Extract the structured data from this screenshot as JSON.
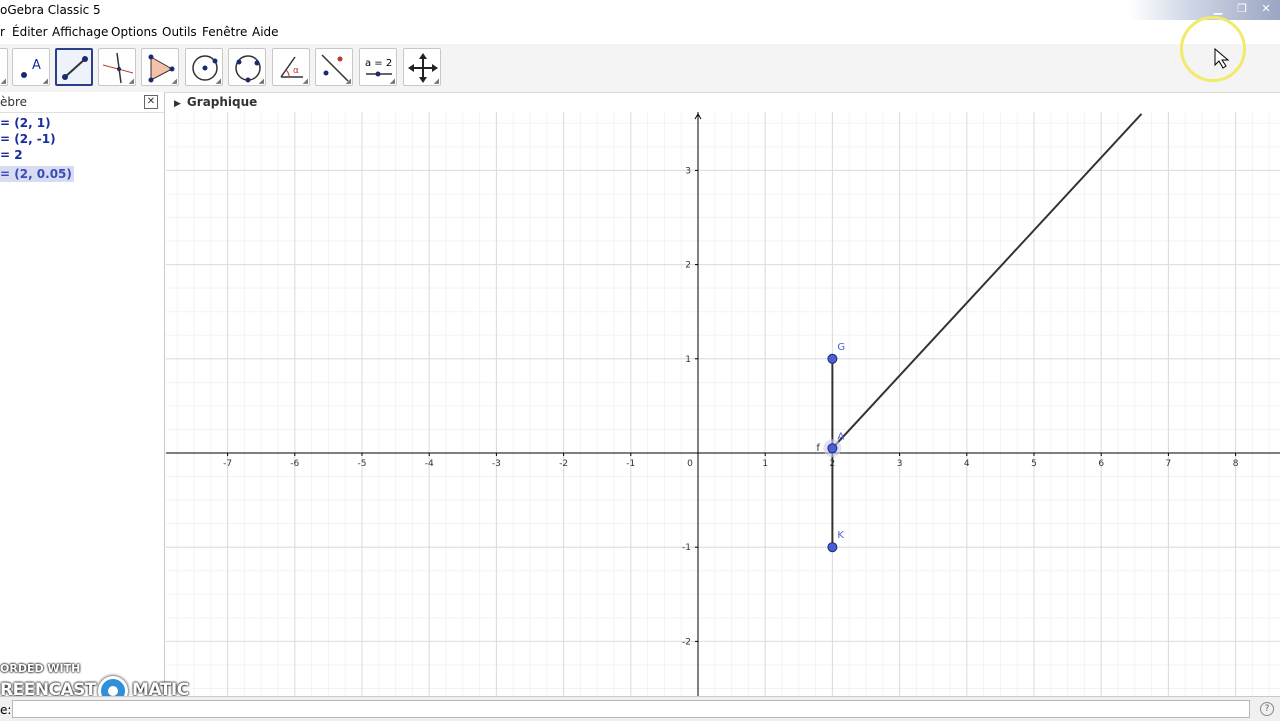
{
  "window": {
    "title": "oGebra Classic 5"
  },
  "menu": [
    "r",
    "Éditer",
    "Affichage",
    "Options",
    "Outils",
    "Fenêtre",
    "Aide"
  ],
  "tools": [
    {
      "name": "move-tool-icon"
    },
    {
      "name": "point-tool-icon",
      "label": "A"
    },
    {
      "name": "line-tool-icon",
      "selected": true
    },
    {
      "name": "perpendicular-tool-icon"
    },
    {
      "name": "polygon-tool-icon"
    },
    {
      "name": "circle-tool-icon"
    },
    {
      "name": "circle-three-points-tool-icon"
    },
    {
      "name": "angle-tool-icon",
      "label": "α"
    },
    {
      "name": "reflect-tool-icon"
    },
    {
      "name": "slider-tool-icon",
      "label": "a = 2"
    },
    {
      "name": "move-graphics-tool-icon"
    }
  ],
  "algebra": {
    "header": "èbre",
    "items": [
      {
        "text": "= (2, 1)",
        "selected": false
      },
      {
        "text": "= (2, -1)",
        "selected": false
      },
      {
        "text": "= 2",
        "selected": false
      },
      {
        "text": "= (2, 0.05)",
        "selected": true
      }
    ]
  },
  "graphics": {
    "header": "Graphique",
    "xrange": [
      -8,
      8.6
    ],
    "yrange": [
      -2.5,
      3.6
    ],
    "xticks": [
      -7,
      -6,
      -5,
      -4,
      -3,
      -2,
      -1,
      0,
      1,
      2,
      3,
      4,
      5,
      6,
      7,
      8
    ],
    "yticks": [
      -2,
      -1,
      1,
      2,
      3
    ],
    "grid": true,
    "points": [
      {
        "name": "G",
        "x": 2,
        "y": 1
      },
      {
        "name": "K",
        "x": 2,
        "y": -1
      },
      {
        "name": "A",
        "x": 2,
        "y": 0.05
      }
    ],
    "segment": {
      "from": [
        2,
        1
      ],
      "to": [
        2,
        -1
      ],
      "label": "f"
    },
    "ray": {
      "from": [
        2,
        0.05
      ],
      "to": [
        6.6,
        3.6
      ]
    },
    "colors": {
      "point": "#4b5fd6",
      "line": "#333333",
      "grid": "#e5e5e5",
      "axis": "#000000"
    }
  },
  "inputbar": {
    "label": "e:",
    "help": "?"
  },
  "watermark": {
    "line1": "ORDED WITH",
    "line2a": "REENCAST",
    "line2b": "MATIC"
  }
}
